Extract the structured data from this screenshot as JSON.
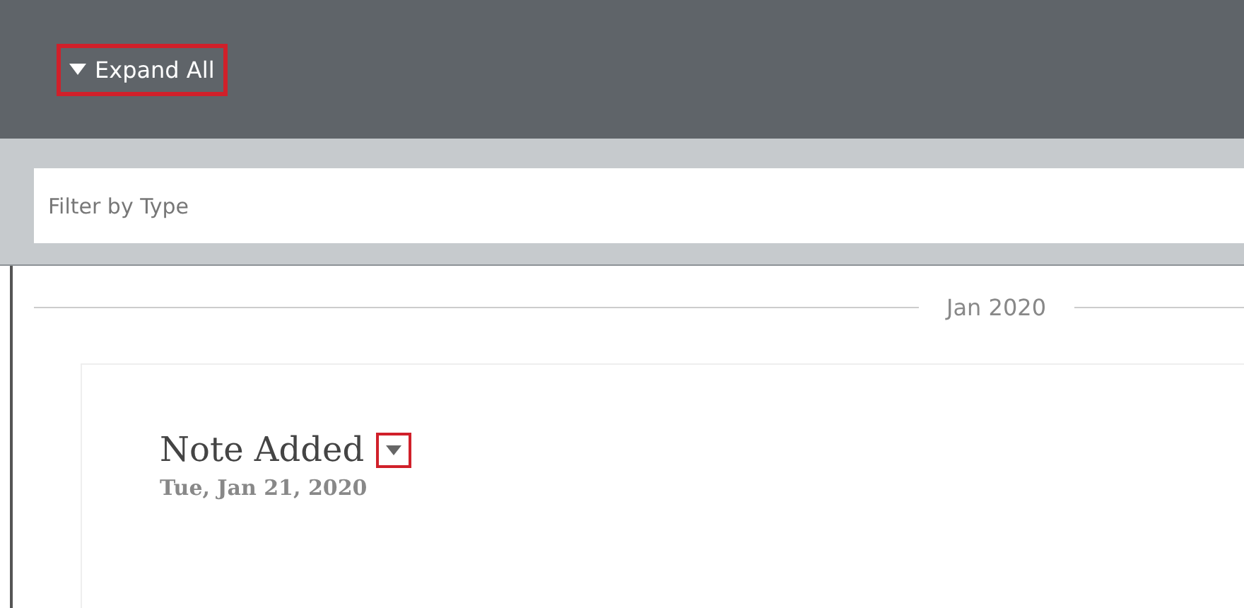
{
  "toolbar": {
    "expand_all": {
      "label": "Expand All",
      "highlighted": true
    }
  },
  "filter": {
    "placeholder": "Filter by Type"
  },
  "timeline": [
    {
      "month": "Jan 2020",
      "events": [
        {
          "title": "Note Added",
          "date": "Tue, Jan 21, 2020",
          "toggle_highlighted": true
        }
      ]
    }
  ]
}
